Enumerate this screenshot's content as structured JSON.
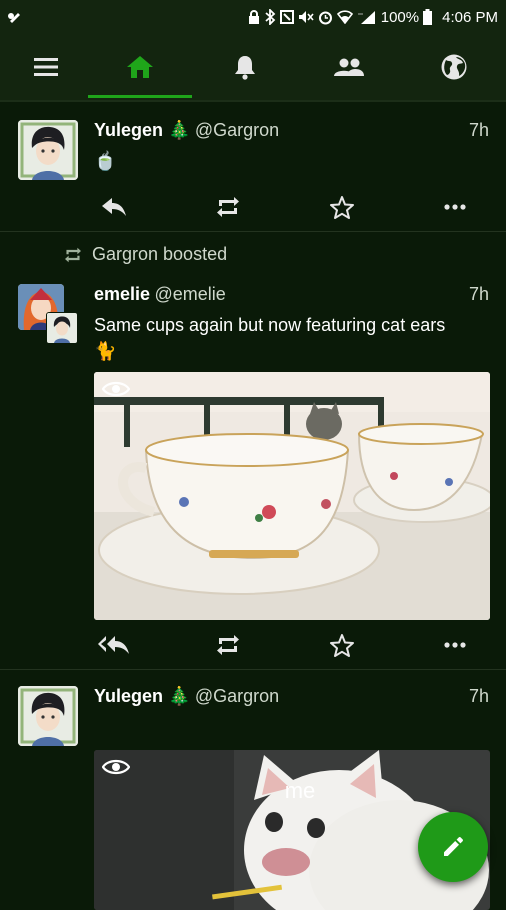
{
  "statusbar": {
    "battery": "100%",
    "time": "4:06 PM"
  },
  "nav": {
    "tabs": [
      "home",
      "notifications",
      "local",
      "federated"
    ],
    "active": "home"
  },
  "feed": {
    "statuses": [
      {
        "display_name": "Yulegen 🎄",
        "acct": "@Gargron",
        "time": "7h",
        "content": "🍵"
      },
      {
        "boosted_by": "Gargron boosted",
        "display_name": "emelie",
        "acct": "@emelie",
        "time": "7h",
        "content_line1": "Same cups again but now featuring cat ears",
        "content_line2": "🐈"
      },
      {
        "display_name": "Yulegen 🎄",
        "acct": "@Gargron",
        "time": "7h",
        "media_caption": "me"
      }
    ]
  },
  "colors": {
    "accent": "#1fa51a",
    "background": "#0a1a08",
    "bar": "#13250f"
  }
}
